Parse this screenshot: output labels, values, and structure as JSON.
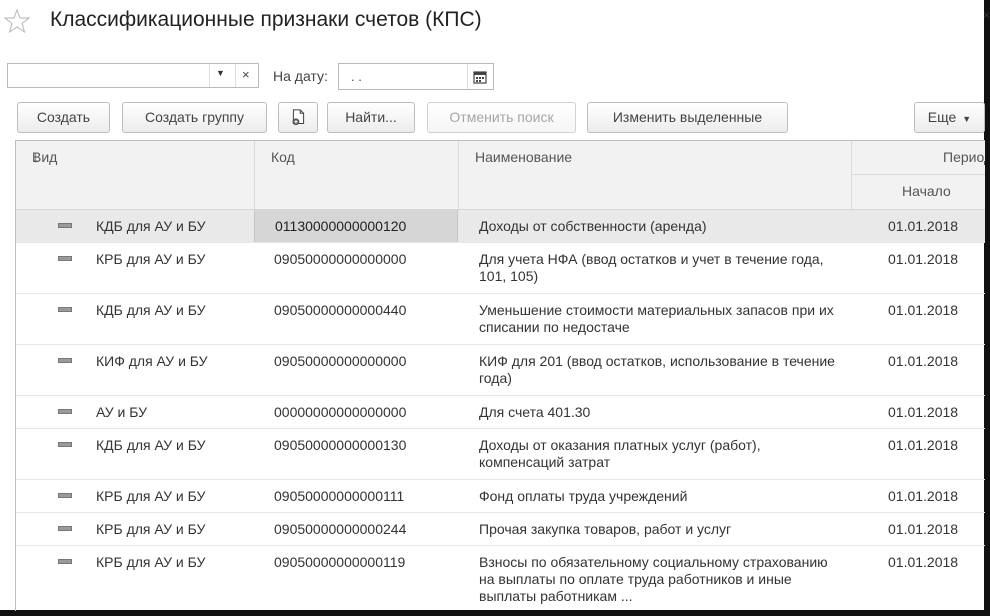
{
  "window": {
    "title": "Классификационные признаки счетов (КПС)",
    "close_glyph": "×"
  },
  "filter": {
    "value": "",
    "dropdown_glyph": "▼",
    "clear_glyph": "×",
    "date_label": "На дату:",
    "date_value": " .  ."
  },
  "toolbar": {
    "create": "Создать",
    "create_group": "Создать группу",
    "find": "Найти...",
    "cancel_search": "Отменить поиск",
    "edit_selected": "Изменить выделенные",
    "more": "Еще",
    "more_caret": "▼"
  },
  "table": {
    "headers": {
      "vid": "Вид",
      "sort_arrow": "↓",
      "kod": "Код",
      "name": "Наименование",
      "period": "Период",
      "start": "Начало"
    },
    "rows": [
      {
        "vid": "КДБ для АУ и БУ",
        "kod": "01130000000000120",
        "name": "Доходы от собственности (аренда)",
        "date": "01.01.2018"
      },
      {
        "vid": "КРБ для АУ и БУ",
        "kod": "09050000000000000",
        "name": "Для учета НФА (ввод остатков и учет в течение года, 101, 105)",
        "date": "01.01.2018"
      },
      {
        "vid": "КДБ для АУ и БУ",
        "kod": "09050000000000440",
        "name": "Уменьшение стоимости материальных запасов при их списании по недостаче",
        "date": "01.01.2018"
      },
      {
        "vid": "КИФ для АУ и БУ",
        "kod": "09050000000000000",
        "name": "КИФ для 201 (ввод остатков, использование в течение года)",
        "date": "01.01.2018"
      },
      {
        "vid": "АУ и БУ",
        "kod": "00000000000000000",
        "name": "Для счета 401.30",
        "date": "01.01.2018"
      },
      {
        "vid": "КДБ для АУ и БУ",
        "kod": "09050000000000130",
        "name": "Доходы от оказания платных услуг (работ), компенсаций затрат",
        "date": "01.01.2018"
      },
      {
        "vid": "КРБ для АУ и БУ",
        "kod": "09050000000000111",
        "name": "Фонд оплаты труда учреждений",
        "date": "01.01.2018"
      },
      {
        "vid": "КРБ для АУ и БУ",
        "kod": "09050000000000244",
        "name": "Прочая закупка товаров, работ и услуг",
        "date": "01.01.2018"
      },
      {
        "vid": "КРБ для АУ и БУ",
        "kod": "09050000000000119",
        "name": "Взносы по обязательному социальному страхованию на выплаты по оплате труда работников и иные выплаты работникам ...",
        "date": "01.01.2018"
      }
    ]
  }
}
